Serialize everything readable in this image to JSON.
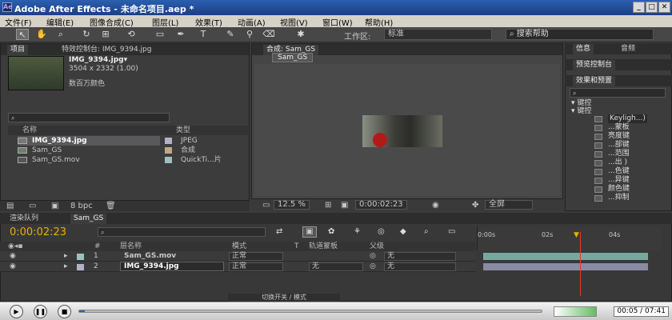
{
  "window": {
    "title": "Adobe After Effects - 未命名项目.aep *",
    "logo": "Ae"
  },
  "menu": [
    "文件(F)",
    "编辑(E)",
    "图像合成(C)",
    "图层(L)",
    "效果(T)",
    "动画(A)",
    "视图(V)",
    "窗口(W)",
    "帮助(H)"
  ],
  "toolbar": {
    "workspace_label": "工作区:",
    "workspace_value": "标准",
    "search_help": "搜索帮助"
  },
  "project": {
    "tabs": [
      "项目",
      "特效控制台: IMG_9394.jpg"
    ],
    "selected_name": "IMG_9394.jpg▾",
    "selected_dims": "3504 x 2332 (1.00)",
    "selected_colors": "数百万颜色",
    "columns": [
      "名称",
      "类型"
    ],
    "items": [
      {
        "name": "IMG_9394.jpg",
        "type": "JPEG",
        "color": "#b2b2c8"
      },
      {
        "name": "Sam_GS",
        "type": "合成",
        "color": "#c2a882"
      },
      {
        "name": "Sam_GS.mov",
        "type": "QuickTi...片",
        "color": "#9fbfbf"
      }
    ],
    "bpc": "8 bpc"
  },
  "comp": {
    "tab": "合成: Sam_GS",
    "sub_tab": "Sam_GS",
    "zoom": "12.5 %",
    "timecode": "0:00:02:23",
    "quality": "全屏"
  },
  "right_panel": {
    "tabs_top": [
      "信息",
      "音频"
    ],
    "tab_preview": "预览控制台",
    "tab_effects": "效果和预置",
    "folder1": "▾ 键控",
    "folder2": "▾ 键控",
    "items": [
      "Keyligh...)",
      "...蒙板",
      "亮度键",
      "...部键",
      "...范围",
      "...出 )",
      "...色键",
      "...异键",
      "颜色键",
      "...抑制"
    ]
  },
  "timeline": {
    "tabs": [
      "渲染队列",
      "Sam_GS"
    ],
    "timecode": "0:00:02:23",
    "columns": [
      "#",
      "层名称",
      "模式",
      "T",
      "轨道蒙板",
      "父级"
    ],
    "layers": [
      {
        "num": "1",
        "name": "Sam_GS.mov",
        "mode": "正常",
        "track": "",
        "parent": "无",
        "color": "#9fbfbf"
      },
      {
        "num": "2",
        "name": "IMG_9394.jpg",
        "mode": "正常",
        "track": "无",
        "parent": "无",
        "color": "#b2b2c8"
      }
    ],
    "ruler": [
      "0:00s",
      "02s",
      "04s"
    ],
    "toggle_label": "切换开关 / 模式"
  },
  "player": {
    "time": "00:05 / 07:41",
    "progress": 0.012
  }
}
